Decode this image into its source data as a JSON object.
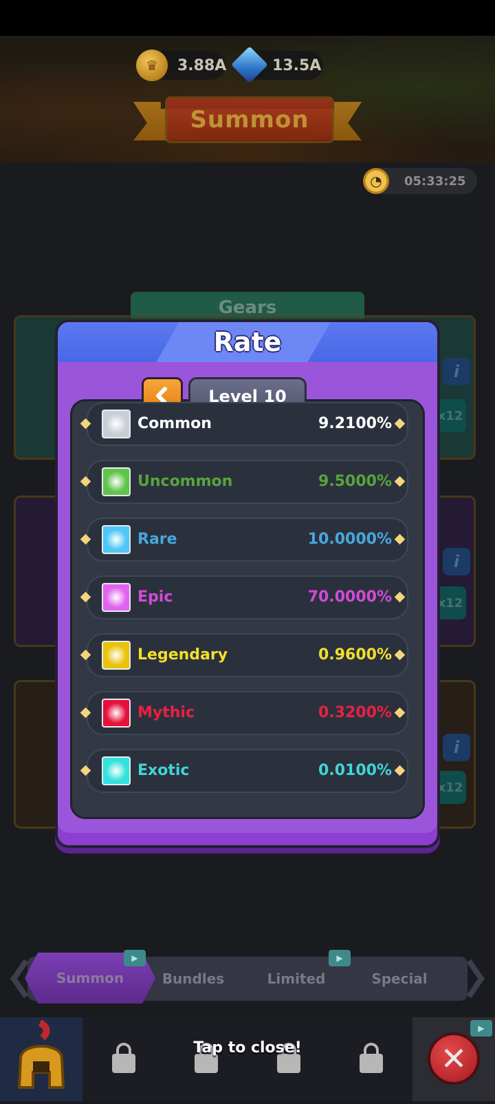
{
  "header": {
    "coins": "3.88A",
    "gems": "13.5A",
    "title": "Summon",
    "timer": "05:33:25"
  },
  "background": {
    "gears_tab": "Gears",
    "info_label": "i",
    "multiplier_label": "x12"
  },
  "modal": {
    "title": "Rate",
    "level_label": "Level 10",
    "rarities": [
      {
        "name": "Common",
        "rate": "9.2100%",
        "color": "#ffffff",
        "swatch": "#c9ced6"
      },
      {
        "name": "Uncommon",
        "rate": "9.5000%",
        "color": "#59a33c",
        "swatch": "#5fc44a"
      },
      {
        "name": "Rare",
        "rate": "10.0000%",
        "color": "#46a8de",
        "swatch": "#4fc6f5"
      },
      {
        "name": "Epic",
        "rate": "70.0000%",
        "color": "#d24ad8",
        "swatch": "#e063f0"
      },
      {
        "name": "Legendary",
        "rate": "0.9600%",
        "color": "#f3df2c",
        "swatch": "#e9c20a"
      },
      {
        "name": "Mythic",
        "rate": "0.3200%",
        "color": "#ea1f45",
        "swatch": "#e5103c"
      },
      {
        "name": "Exotic",
        "rate": "0.0100%",
        "color": "#3fd6d6",
        "swatch": "#33e2dc"
      }
    ]
  },
  "shop_tabs": {
    "summon": "Summon",
    "bundles": "Bundles",
    "limited": "Limited",
    "special": "Special"
  },
  "footer": {
    "tap_to_close": "Tap to close!"
  },
  "icons": {
    "coin": "crown-coin-icon",
    "gem": "blue-gem-icon",
    "clock": "clock-icon",
    "back": "chevron-left-icon",
    "close": "close-icon",
    "lock": "lock-icon",
    "video": "video-ad-icon",
    "hero": "spartan-helmet-icon"
  }
}
